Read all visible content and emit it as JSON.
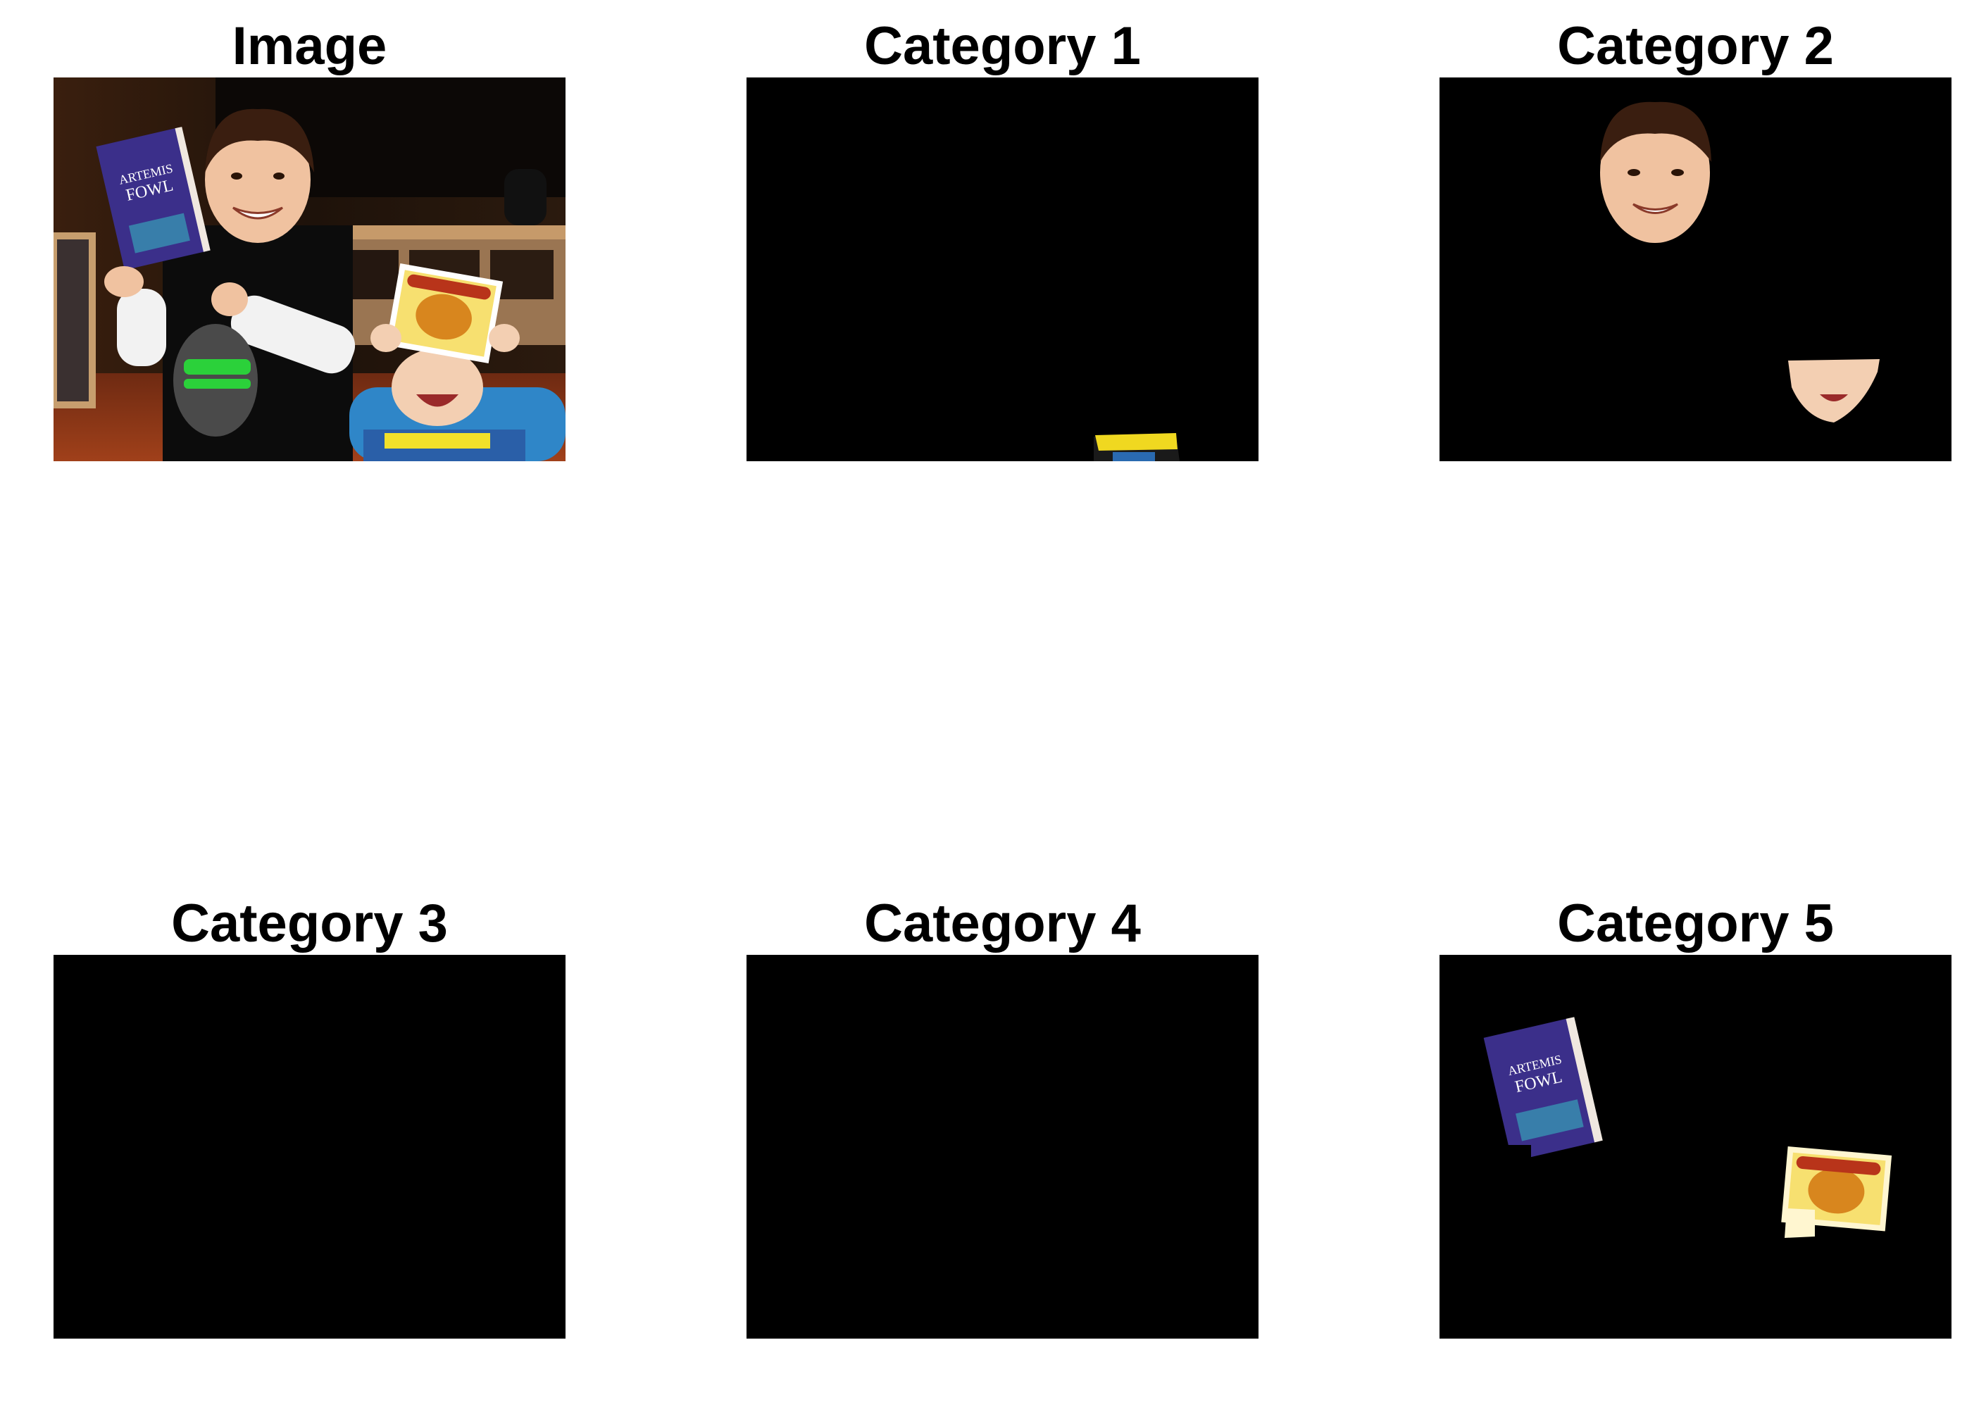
{
  "figure": {
    "panels": [
      {
        "id": "image",
        "title": "Image",
        "content": "photo of two children holding books, Artemis Fowl and Gingerbread book"
      },
      {
        "id": "cat1",
        "title": "Category 1",
        "content": "black mask with yellow shirt text region"
      },
      {
        "id": "cat2",
        "title": "Category 2",
        "content": "black mask with two faces visible"
      },
      {
        "id": "cat3",
        "title": "Category 3",
        "content": "black mask"
      },
      {
        "id": "cat4",
        "title": "Category 4",
        "content": "black mask"
      },
      {
        "id": "cat5",
        "title": "Category 5",
        "content": "black mask with two books visible"
      }
    ],
    "colors": {
      "background": "#ffffff",
      "mask": "#000000",
      "text": "#000000"
    }
  }
}
